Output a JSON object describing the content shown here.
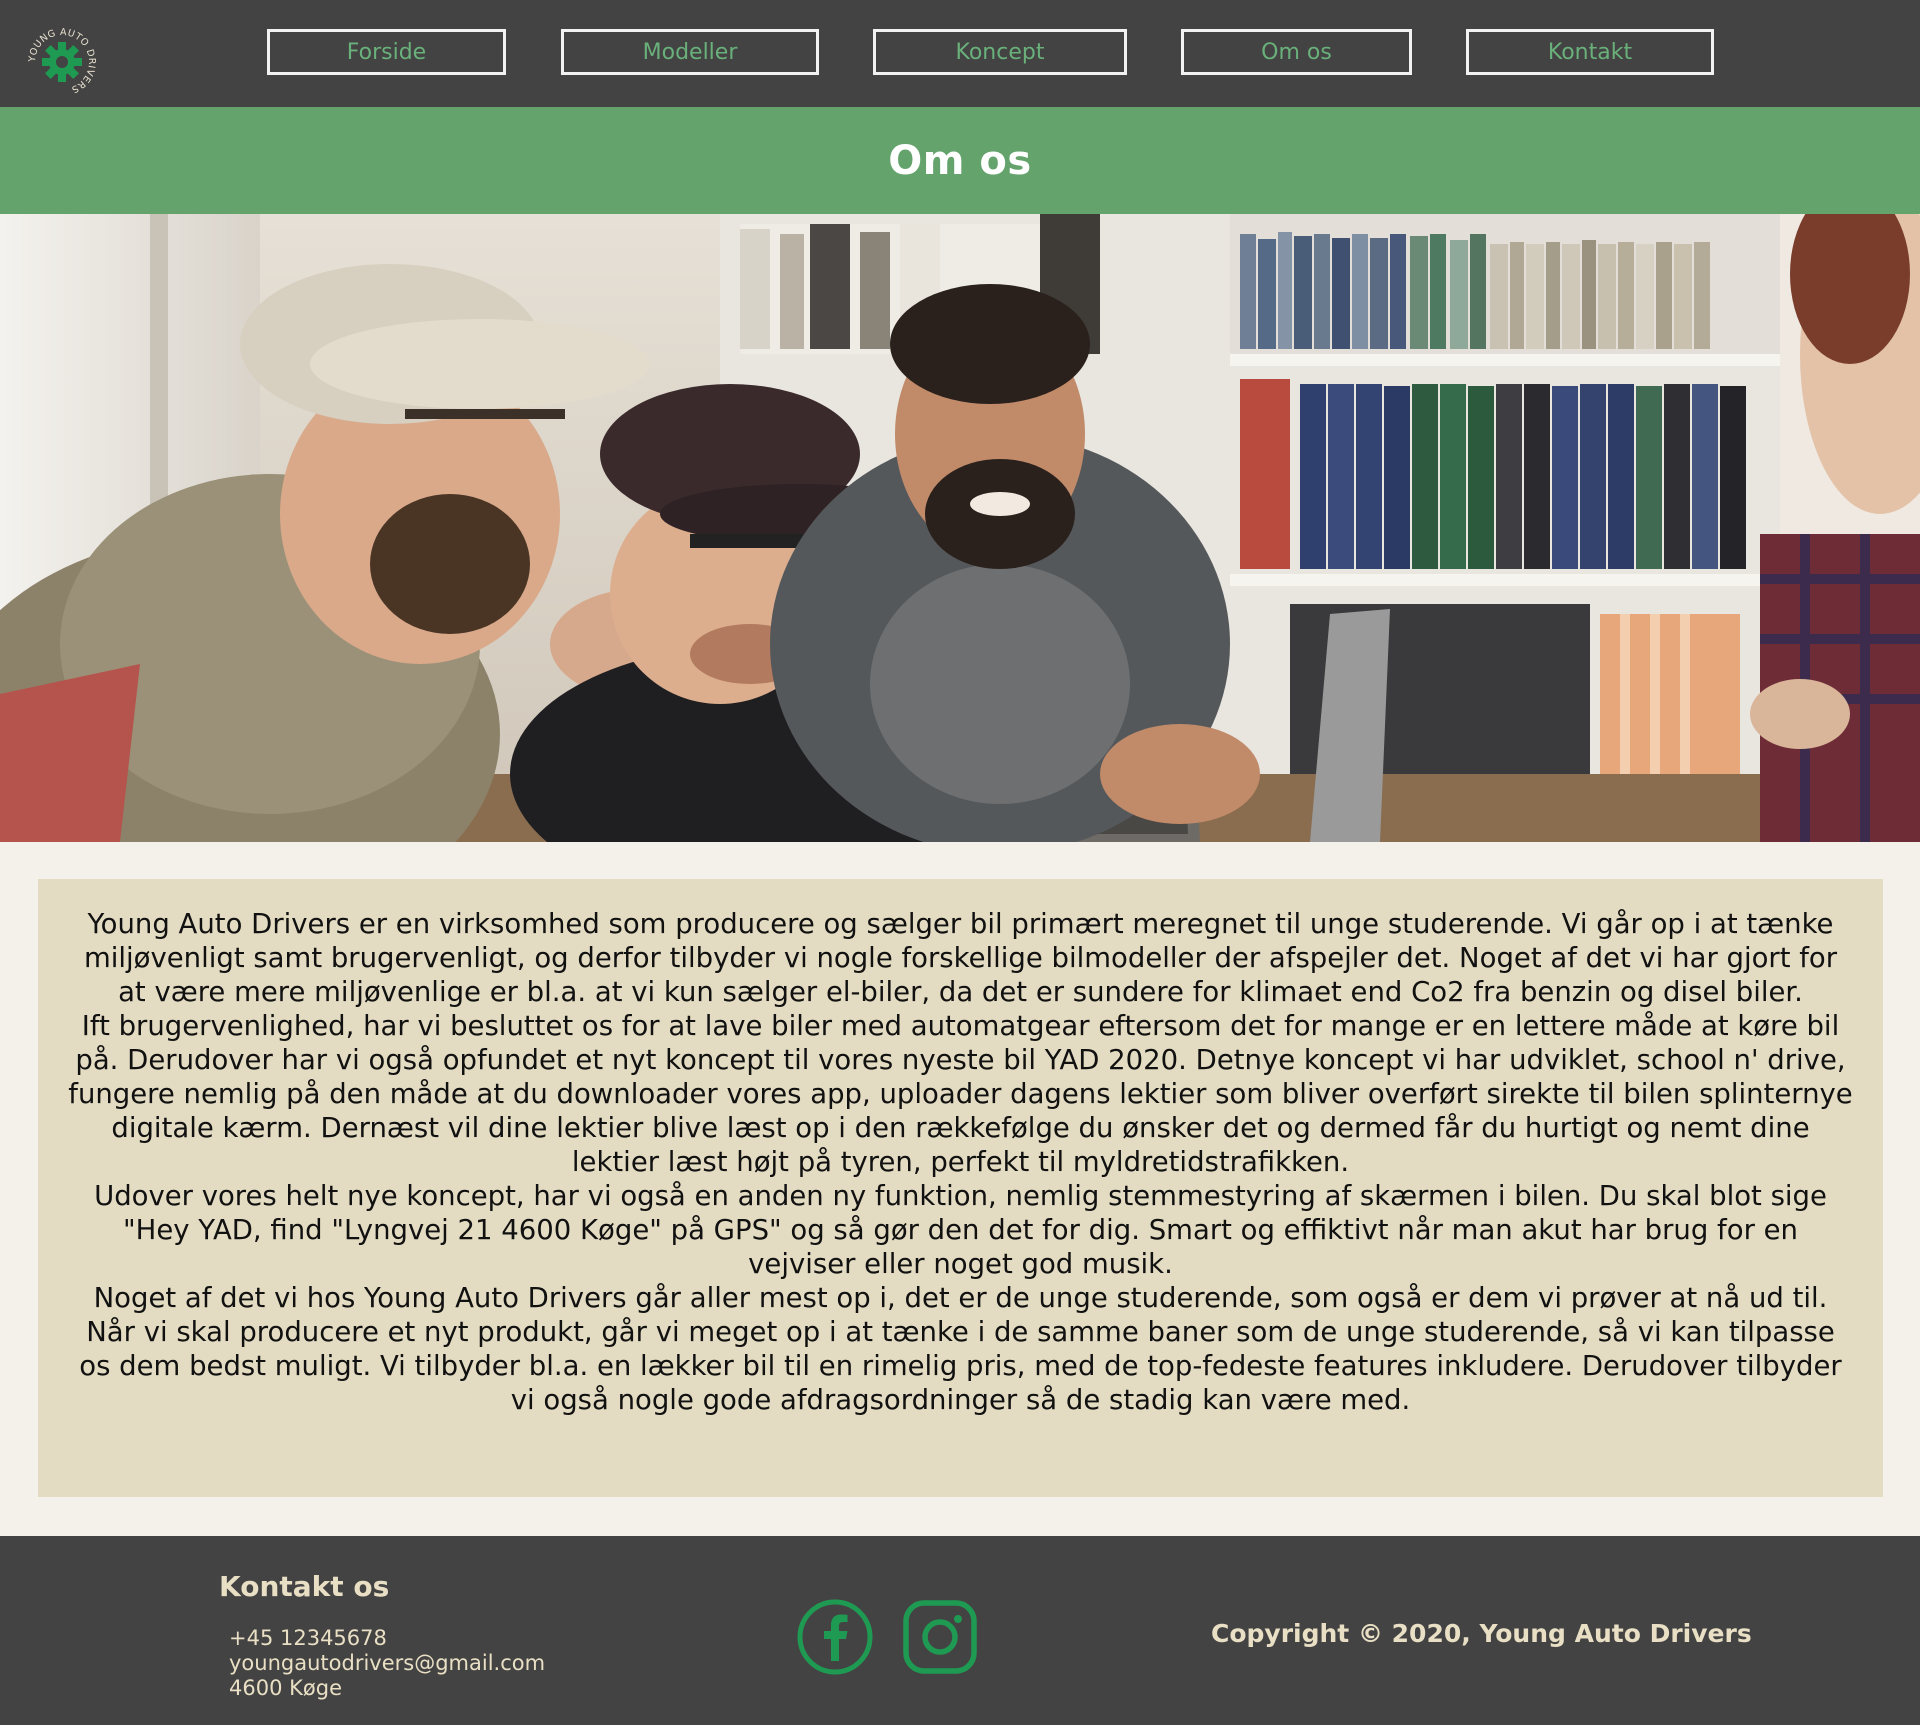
{
  "brand": {
    "logo_text": "YOUNG AUTO DRIVERS",
    "accent_color": "#65a36d",
    "header_color": "#434343"
  },
  "nav": {
    "items": [
      {
        "label": "Forside"
      },
      {
        "label": "Modeller"
      },
      {
        "label": "Koncept"
      },
      {
        "label": "Om os"
      },
      {
        "label": "Kontakt"
      }
    ]
  },
  "page": {
    "title": "Om os"
  },
  "hero": {
    "icon": "photo-of-laughing-students-at-laptop"
  },
  "about": {
    "paragraphs": [
      "Young Auto Drivers er en virksomhed som producere og sælger bil primært meregnet til unge studerende. Vi går op i at tænke miljøvenligt samt brugervenligt, og derfor tilbyder vi nogle forskellige bilmodeller der afspejler det. Noget af det vi har gjort for at være mere miljøvenlige er bl.a. at vi kun sælger el-biler, da det er sundere for klimaet end Co2 fra benzin og disel biler.",
      "Ift brugervenlighed, har vi besluttet os for at lave biler med automatgear eftersom det for mange er en lettere måde at køre bil på. Derudover har vi også opfundet et nyt koncept til vores nyeste bil YAD 2020. Detnye koncept vi har udviklet, school n' drive, fungere nemlig på den måde at du downloader vores app, uploader dagens lektier som bliver overført sirekte til bilen splinternye digitale kærm. Dernæst vil dine lektier blive læst op i den rækkefølge du ønsker det og dermed får du hurtigt og nemt dine lektier læst højt på tyren, perfekt til myldretidstrafikken.",
      "Udover vores helt nye koncept, har vi også en anden ny funktion, nemlig stemmestyring af skærmen i bilen. Du skal blot sige \"Hey YAD, find \"Lyngvej 21 4600 Køge\" på GPS\" og så gør den det for dig. Smart og effiktivt når man akut har brug for en vejviser eller noget god musik.",
      "Noget af det vi hos Young Auto Drivers går aller mest op i, det er de unge studerende, som også er dem vi prøver at nå ud til. Når vi skal producere et nyt produkt, går vi meget op i at tænke i de samme baner som de unge studerende, så vi kan tilpasse os dem bedst muligt. Vi tilbyder bl.a. en lækker bil til en rimelig pris, med de top-fedeste features inkludere. Derudover tilbyder vi også nogle gode afdragsordninger så de stadig kan være med."
    ]
  },
  "footer": {
    "contact_title": "Kontakt os",
    "phone": "+45 12345678",
    "email": "youngautodrivers@gmail.com",
    "city": "4600 Køge",
    "social": [
      {
        "icon": "facebook-icon"
      },
      {
        "icon": "instagram-icon"
      }
    ],
    "social_color": "#1f9a52",
    "copyright": "Copyright © 2020, Young Auto Drivers"
  }
}
